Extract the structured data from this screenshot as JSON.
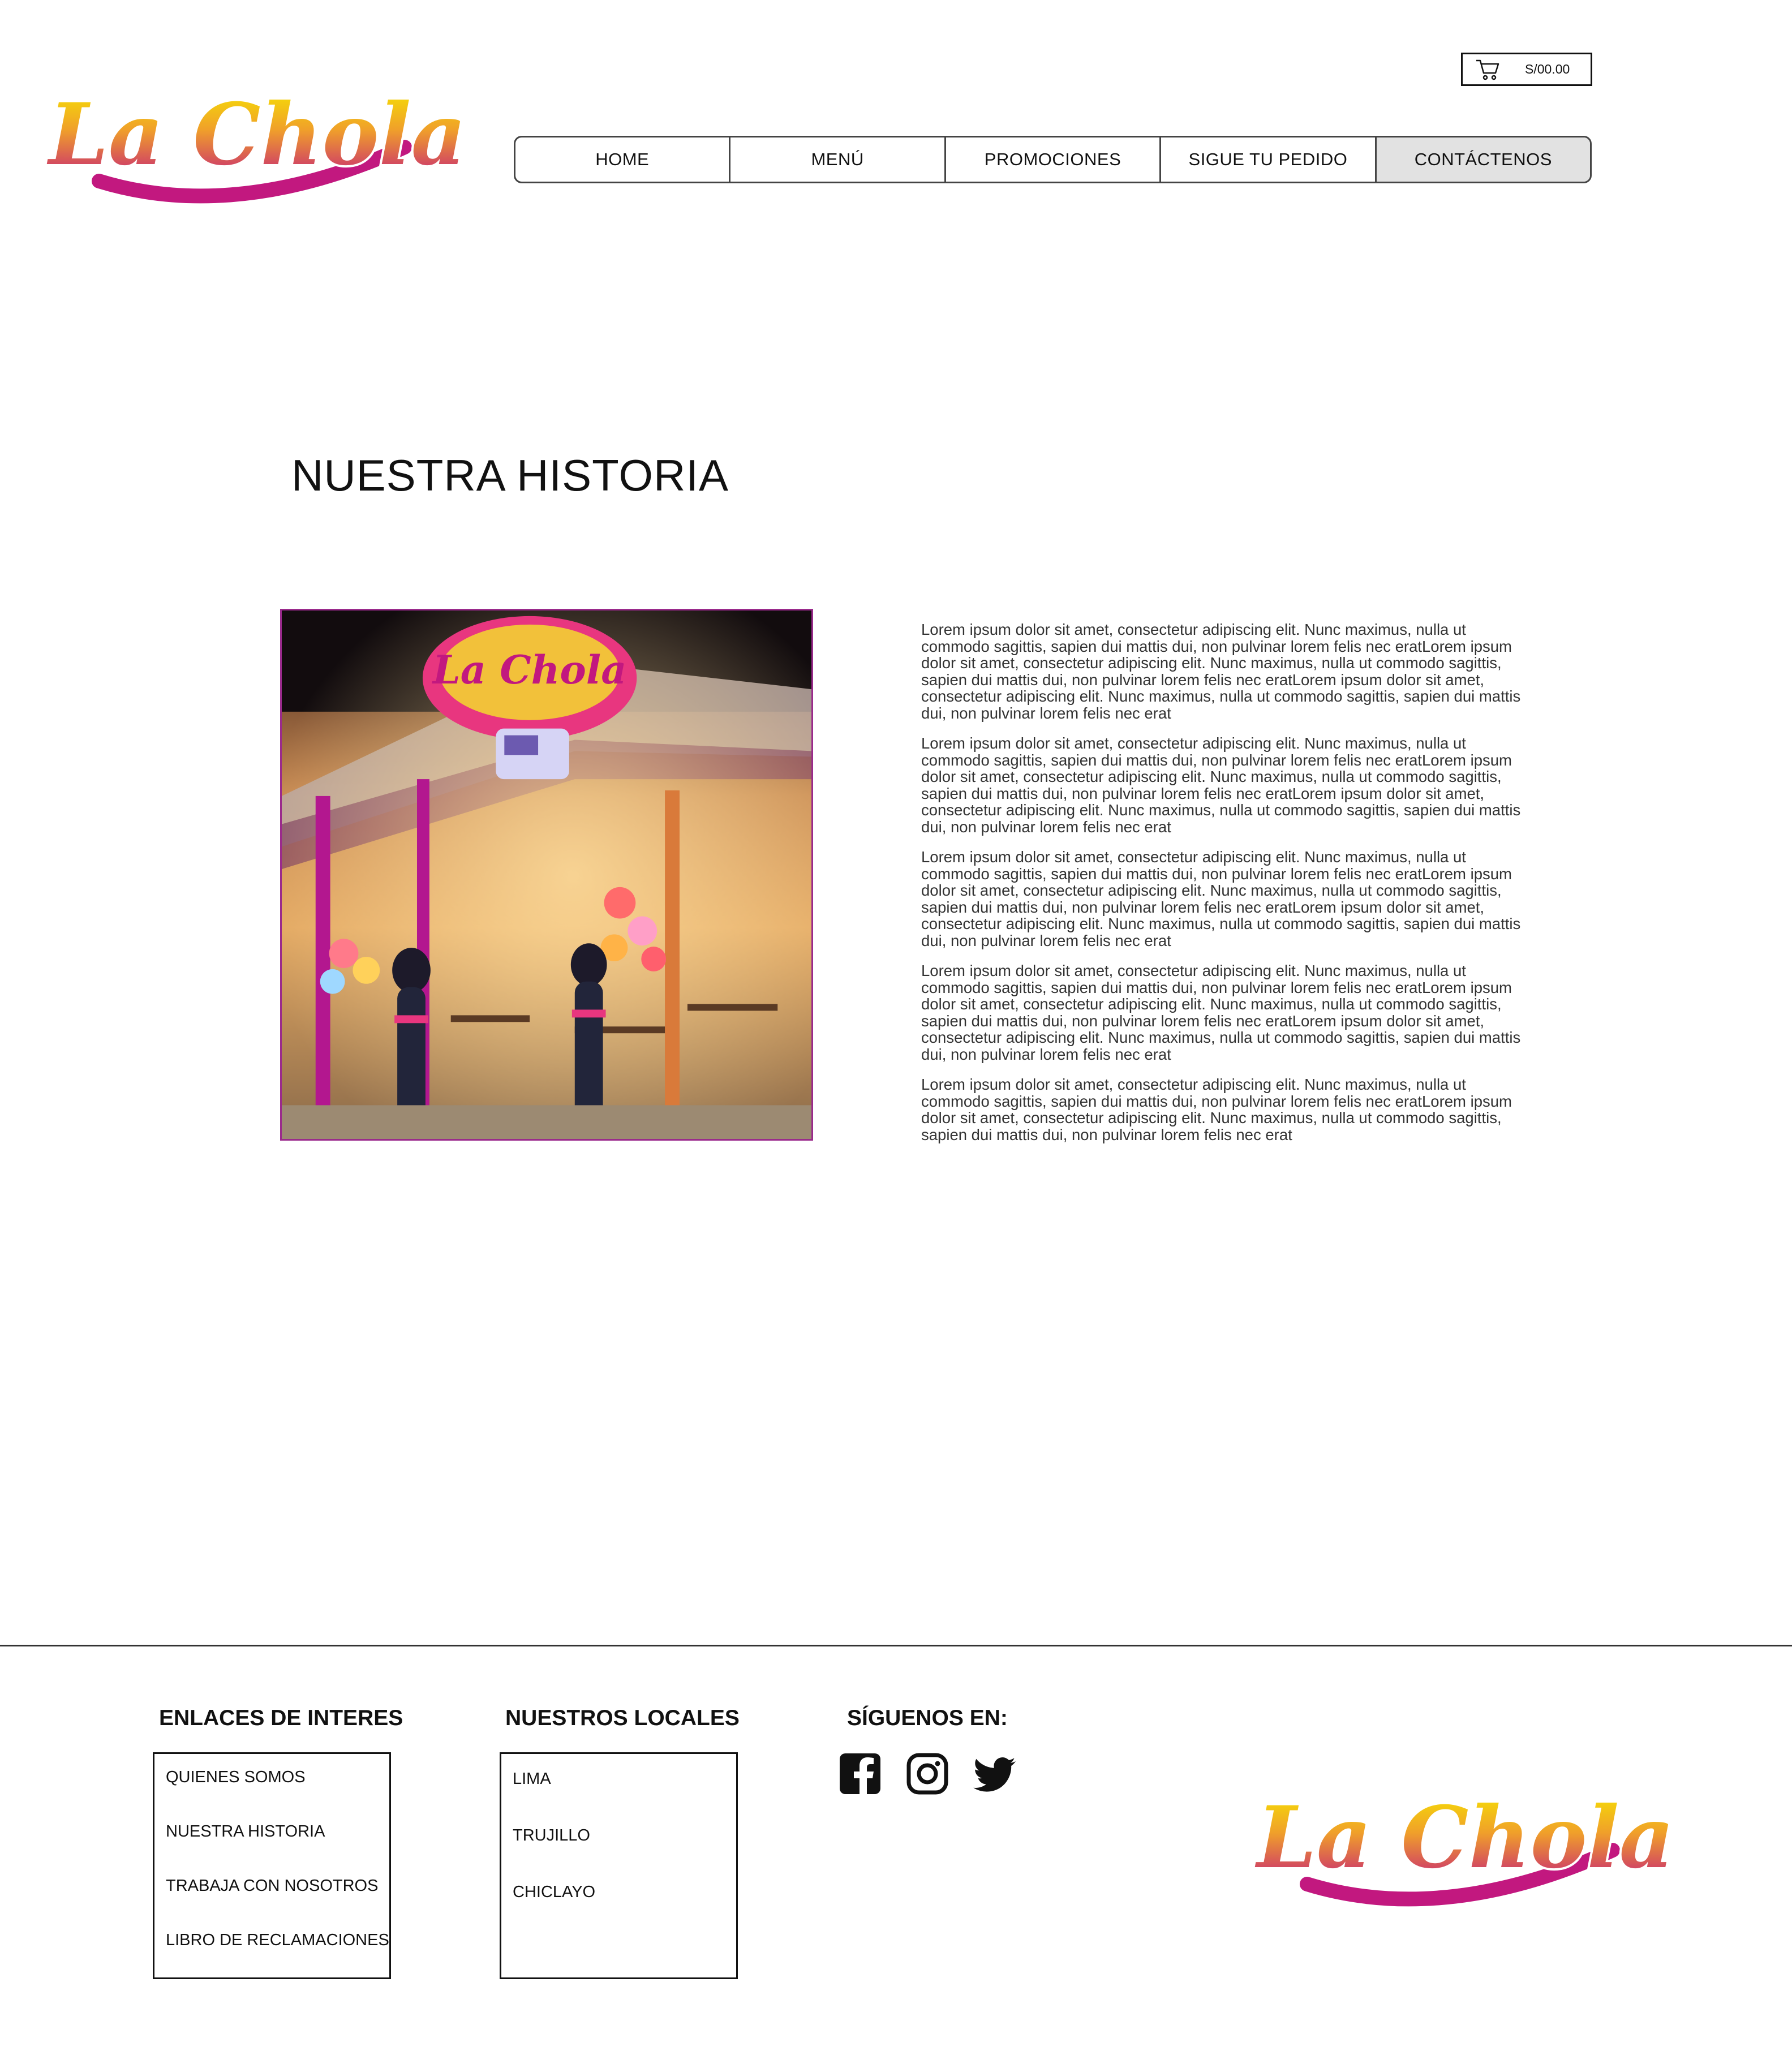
{
  "brand": {
    "logo_text": "La Chola"
  },
  "cart": {
    "icon": "shopping-cart-icon",
    "total": "S/00.00"
  },
  "nav": {
    "items": [
      {
        "label": "HOME"
      },
      {
        "label": "MENÚ"
      },
      {
        "label": "PROMOCIONES"
      },
      {
        "label": "SIGUE TU PEDIDO"
      },
      {
        "label": "CONTÁCTENOS",
        "active": true
      }
    ]
  },
  "main": {
    "title": "NUESTRA HISTORIA",
    "paragraphs": [
      "Lorem ipsum dolor sit amet, consectetur adipiscing elit. Nunc maximus, nulla ut commodo sagittis, sapien dui mattis dui, non pulvinar lorem felis nec eratLorem ipsum dolor sit amet, consectetur adipiscing elit. Nunc maximus, nulla ut commodo sagittis, sapien dui mattis dui, non pulvinar lorem felis nec eratLorem ipsum dolor sit amet, consectetur adipiscing elit. Nunc maximus, nulla ut commodo sagittis, sapien dui mattis dui, non pulvinar lorem felis nec erat",
      "Lorem ipsum dolor sit amet, consectetur adipiscing elit. Nunc maximus, nulla ut commodo sagittis, sapien dui mattis dui, non pulvinar lorem felis nec eratLorem ipsum dolor sit amet, consectetur adipiscing elit. Nunc maximus, nulla ut commodo sagittis, sapien dui mattis dui, non pulvinar lorem felis nec eratLorem ipsum dolor sit amet, consectetur adipiscing elit. Nunc maximus, nulla ut commodo sagittis, sapien dui mattis dui, non pulvinar lorem felis nec erat",
      "Lorem ipsum dolor sit amet, consectetur adipiscing elit. Nunc maximus, nulla ut commodo sagittis, sapien dui mattis dui, non pulvinar lorem felis nec eratLorem ipsum dolor sit amet, consectetur adipiscing elit. Nunc maximus, nulla ut commodo sagittis, sapien dui mattis dui, non pulvinar lorem felis nec eratLorem ipsum dolor sit amet, consectetur adipiscing elit. Nunc maximus, nulla ut commodo sagittis, sapien dui mattis dui, non pulvinar lorem felis nec erat",
      "Lorem ipsum dolor sit amet, consectetur adipiscing elit. Nunc maximus, nulla ut commodo sagittis, sapien dui mattis dui, non pulvinar lorem felis nec eratLorem ipsum dolor sit amet, consectetur adipiscing elit. Nunc maximus, nulla ut commodo sagittis, sapien dui mattis dui, non pulvinar lorem felis nec eratLorem ipsum dolor sit amet, consectetur adipiscing elit. Nunc maximus, nulla ut commodo sagittis, sapien dui mattis dui, non pulvinar lorem felis nec erat",
      "Lorem ipsum dolor sit amet, consectetur adipiscing elit. Nunc maximus, nulla ut commodo sagittis, sapien dui mattis dui, non pulvinar lorem felis nec eratLorem ipsum dolor sit amet, consectetur adipiscing elit. Nunc maximus, nulla ut commodo sagittis, sapien dui mattis dui, non pulvinar lorem felis nec erat"
    ]
  },
  "footer": {
    "links_title": "ENLACES DE INTERES",
    "links": [
      "QUIENES SOMOS",
      "NUESTRA HISTORIA",
      "TRABAJA CON NOSOTROS",
      "LIBRO DE RECLAMACIONES"
    ],
    "locales_title": "NUESTROS LOCALES",
    "locales": [
      "LIMA",
      "TRUJILLO",
      "CHICLAYO"
    ],
    "social_title": "SÍGUENOS EN:",
    "social": [
      "facebook-icon",
      "instagram-icon",
      "twitter-icon"
    ]
  },
  "colors": {
    "brand_magenta": "#c2187f",
    "brand_yellow": "#f5d000",
    "active_tab": "#e2e2e2"
  }
}
